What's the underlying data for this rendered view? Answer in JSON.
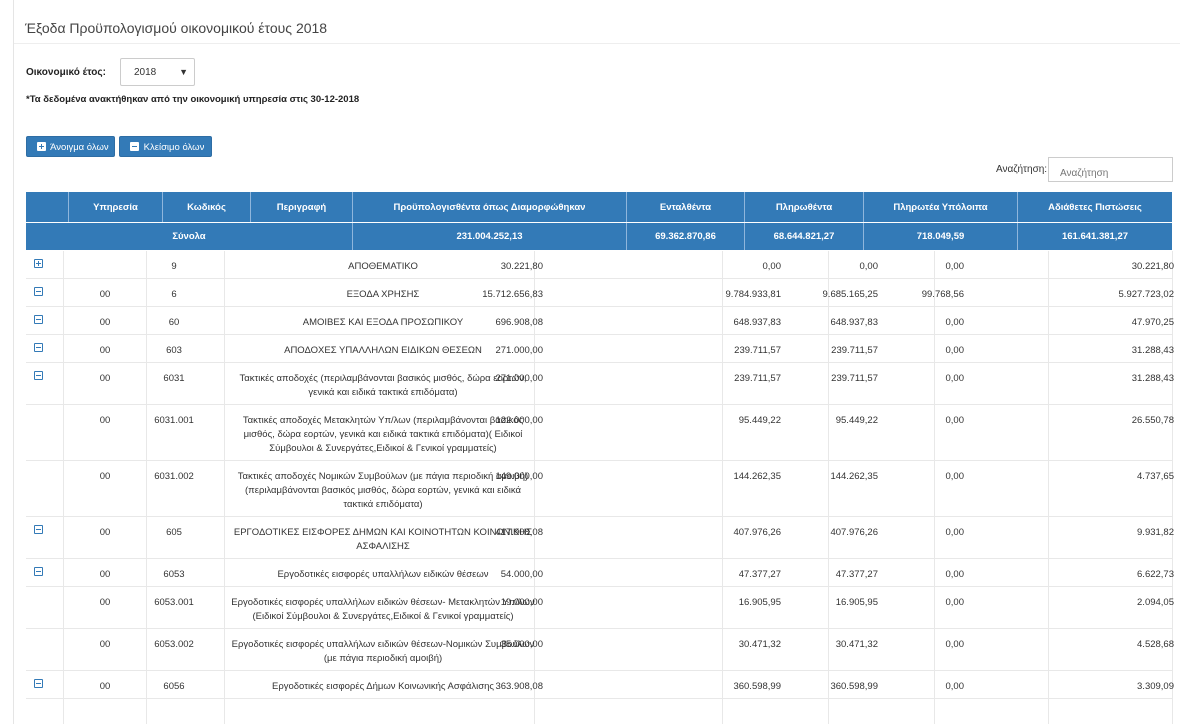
{
  "page": {
    "title": "Έξοδα Προϋπολογισμού οικονομικού έτους 2018",
    "year_label": "Οικονομικό έτος:",
    "year_value": "2018",
    "notice": "*Τα δεδομένα ανακτήθηκαν από την οικονομική υπηρεσία στις 30-12-2018"
  },
  "toolbar": {
    "expand_all_label": "Άνοιγμα όλων",
    "collapse_all_label": "Κλείσιμο όλων",
    "search_label": "Αναζήτηση:",
    "search_placeholder": "Αναζήτηση"
  },
  "table": {
    "columns": [
      "Υπηρεσία",
      "Κωδικός",
      "Περιγραφή",
      "Προϋπολογισθέντα όπως Διαμορφώθηκαν",
      "Ενταλθέντα",
      "Πληρωθέντα",
      "Πληρωτέα Υπόλοιπα",
      "Αδιάθετες Πιστώσεις"
    ],
    "totals": {
      "label": "Σύνολα",
      "budget": "231.004.252,13",
      "entalthenta": "69.362.870,86",
      "plirothenta": "68.644.821,27",
      "pliroteа_ypoloipa": "718.049,59",
      "adiathetes": "161.641.381,27"
    },
    "rows": [
      {
        "toggle": "plus",
        "service": "",
        "code": "9",
        "desc": "ΑΠΟΘΕΜΑΤΙΚΟ",
        "budget": "30.221,80",
        "entalthenta": "0,00",
        "plirothenta": "0,00",
        "ypoloipa": "0,00",
        "adiathetes": "30.221,80"
      },
      {
        "toggle": "minus",
        "service": "00",
        "code": "6",
        "desc": "ΕΞΟΔΑ ΧΡΗΣΗΣ",
        "budget": "15.712.656,83",
        "entalthenta": "9.784.933,81",
        "plirothenta": "9.685.165,25",
        "ypoloipa": "99.768,56",
        "adiathetes": "5.927.723,02"
      },
      {
        "toggle": "minus",
        "service": "00",
        "code": "60",
        "desc": "ΑΜΟΙΒΕΣ ΚΑΙ ΕΞΟΔΑ ΠΡΟΣΩΠΙΚΟΥ",
        "budget": "696.908,08",
        "entalthenta": "648.937,83",
        "plirothenta": "648.937,83",
        "ypoloipa": "0,00",
        "adiathetes": "47.970,25"
      },
      {
        "toggle": "minus",
        "service": "00",
        "code": "603",
        "desc": "ΑΠΟΔΟΧΕΣ ΥΠΑΛΛΗΛΩΝ ΕΙΔΙΚΩΝ ΘΕΣΕΩΝ",
        "budget": "271.000,00",
        "entalthenta": "239.711,57",
        "plirothenta": "239.711,57",
        "ypoloipa": "0,00",
        "adiathetes": "31.288,43"
      },
      {
        "toggle": "minus",
        "service": "00",
        "code": "6031",
        "desc": "Τακτικές αποδοχές (περιλαμβάνονται βασικός μισθός, δώρα εορτών, γενικά και ειδικά τακτικά επιδόματα)",
        "budget": "271.000,00",
        "entalthenta": "239.711,57",
        "plirothenta": "239.711,57",
        "ypoloipa": "0,00",
        "adiathetes": "31.288,43"
      },
      {
        "toggle": "",
        "service": "00",
        "code": "6031.001",
        "desc": "Τακτικές αποδοχές Μετακλητών Υπ/λων (περιλαμβάνονται βασικός μισθός, δώρα εορτών, γενικά και ειδικά τακτικά επιδόματα)( Ειδικοί Σύμβουλοι & Συνεργάτες,Ειδικοί & Γενικοί γραμματείς)",
        "budget": "122.000,00",
        "entalthenta": "95.449,22",
        "plirothenta": "95.449,22",
        "ypoloipa": "0,00",
        "adiathetes": "26.550,78"
      },
      {
        "toggle": "",
        "service": "00",
        "code": "6031.002",
        "desc": "Τακτικές αποδοχές Νομικών Συμβούλων (με πάγια περιοδική αμοιβή) (περιλαμβάνονται βασικός μισθός, δώρα εορτών, γενικά και ειδικά τακτικά επιδόματα)",
        "budget": "149.000,00",
        "entalthenta": "144.262,35",
        "plirothenta": "144.262,35",
        "ypoloipa": "0,00",
        "adiathetes": "4.737,65"
      },
      {
        "toggle": "minus",
        "service": "00",
        "code": "605",
        "desc": "ΕΡΓΟΔΟΤΙΚΕΣ ΕΙΣΦΟΡΕΣ ΔΗΜΩΝ ΚΑΙ ΚΟΙΝΟΤΗΤΩΝ ΚΟΙΝΩΝΙΚΗΣ ΑΣΦΑΛΙΣΗΣ",
        "budget": "417.908,08",
        "entalthenta": "407.976,26",
        "plirothenta": "407.976,26",
        "ypoloipa": "0,00",
        "adiathetes": "9.931,82"
      },
      {
        "toggle": "minus",
        "service": "00",
        "code": "6053",
        "desc": "Εργοδοτικές εισφορές υπαλλήλων ειδικών θέσεων",
        "budget": "54.000,00",
        "entalthenta": "47.377,27",
        "plirothenta": "47.377,27",
        "ypoloipa": "0,00",
        "adiathetes": "6.622,73"
      },
      {
        "toggle": "",
        "service": "00",
        "code": "6053.001",
        "desc": "Εργοδοτικές εισφορές υπαλλήλων ειδικών θέσεων- Μετακλητών Υπ/λων (Ειδικοί Σύμβουλοι & Συνεργάτες,Ειδικοί & Γενικοί γραμματείς)",
        "budget": "19.000,00",
        "entalthenta": "16.905,95",
        "plirothenta": "16.905,95",
        "ypoloipa": "0,00",
        "adiathetes": "2.094,05"
      },
      {
        "toggle": "",
        "service": "00",
        "code": "6053.002",
        "desc": "Εργοδοτικές εισφορές υπαλλήλων ειδικών θέσεων-Νομικών Συμβούλων (με πάγια περιοδική αμοιβή)",
        "budget": "35.000,00",
        "entalthenta": "30.471,32",
        "plirothenta": "30.471,32",
        "ypoloipa": "0,00",
        "adiathetes": "4.528,68"
      },
      {
        "toggle": "minus",
        "service": "00",
        "code": "6056",
        "desc": "Εργοδοτικές εισφορές Δήμων Κοινωνικής Ασφάλισης",
        "budget": "363.908,08",
        "entalthenta": "360.598,99",
        "plirothenta": "360.598,99",
        "ypoloipa": "0,00",
        "adiathetes": "3.309,09"
      }
    ]
  }
}
